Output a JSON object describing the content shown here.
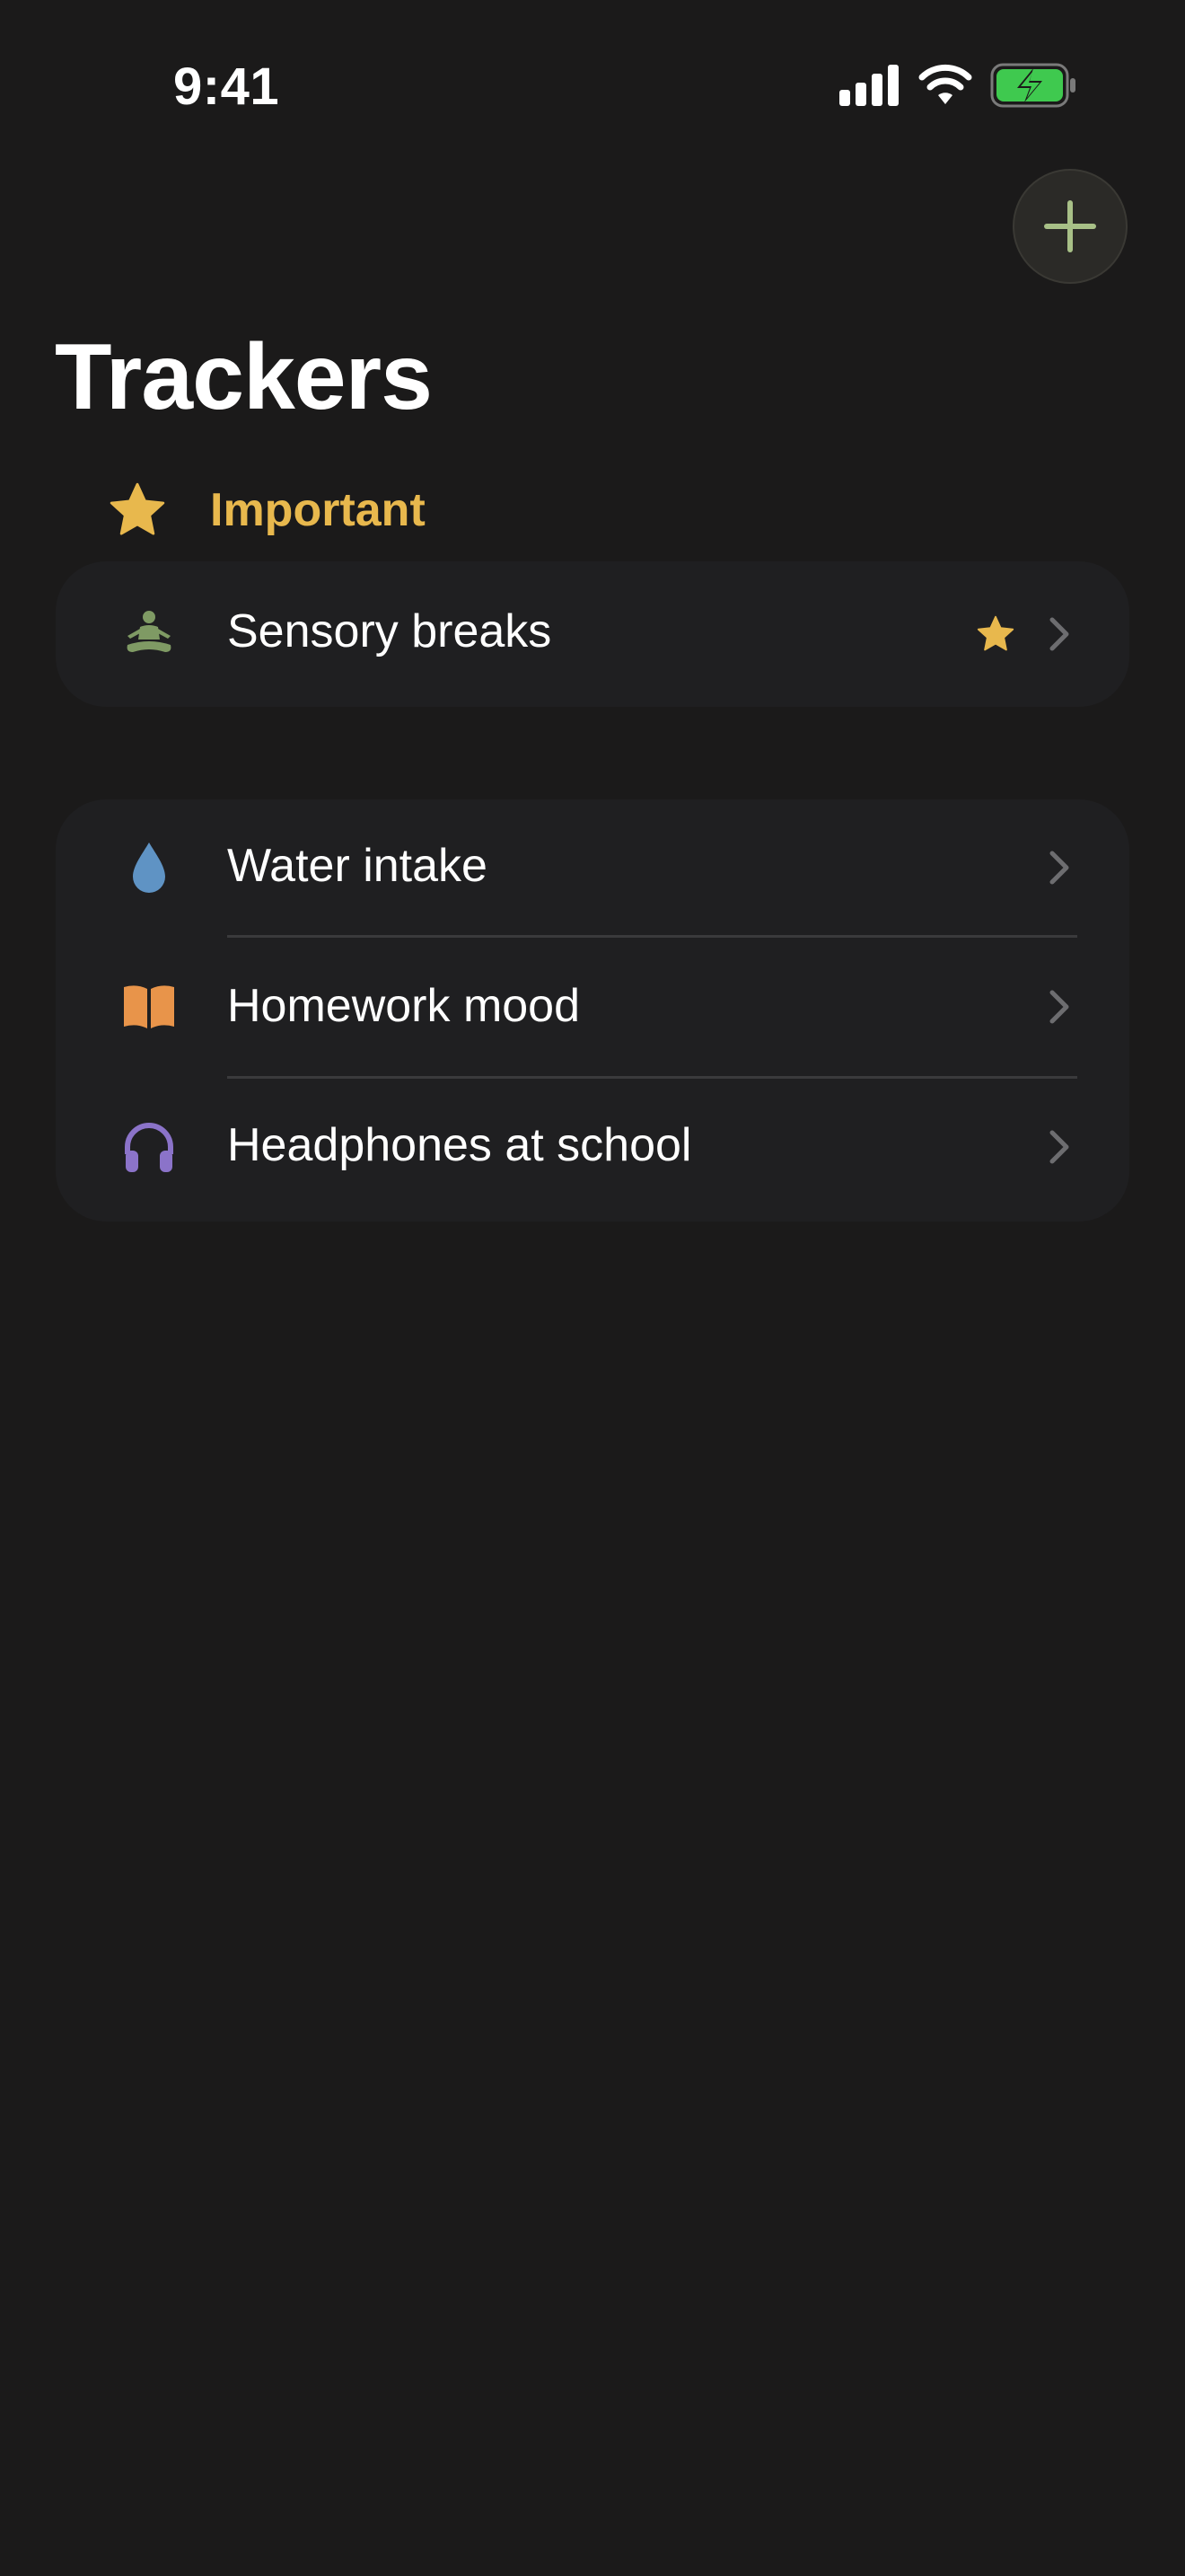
{
  "status_bar": {
    "time": "9:41"
  },
  "header": {
    "title": "Trackers",
    "add_icon": "plus-icon"
  },
  "important_section": {
    "label": "Important",
    "icon": "star-icon",
    "items": [
      {
        "label": "Sensory breaks",
        "icon": "meditation-icon",
        "icon_color": "#7f9a64",
        "favorite": true
      }
    ]
  },
  "trackers": {
    "items": [
      {
        "label": "Water intake",
        "icon": "water-drop-icon",
        "icon_color": "#5f93c4"
      },
      {
        "label": "Homework mood",
        "icon": "open-book-icon",
        "icon_color": "#e8944a"
      },
      {
        "label": "Headphones at school",
        "icon": "headphones-icon",
        "icon_color": "#8b73c9"
      }
    ]
  },
  "colors": {
    "background": "#1b1a1a",
    "card": "#1f1f21",
    "accent_gold": "#e8b84d",
    "add_plus": "#a8c087",
    "chevron": "#6d6d70",
    "battery_green": "#3fc94f"
  }
}
